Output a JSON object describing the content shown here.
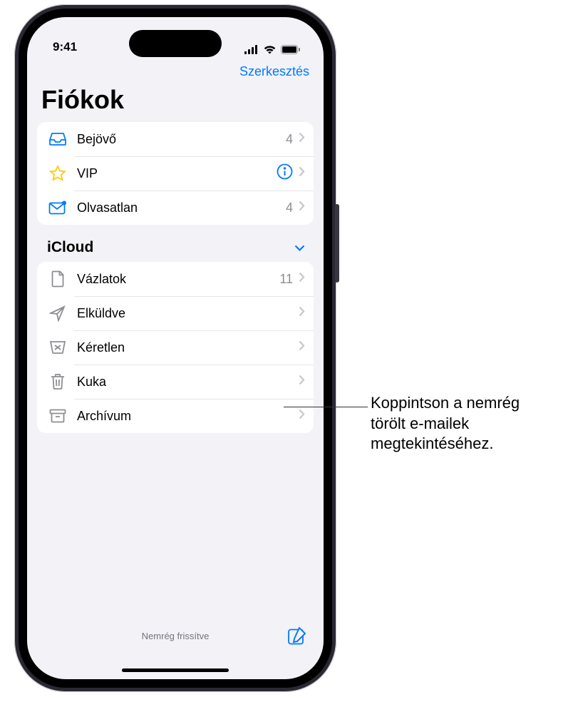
{
  "status": {
    "time": "9:41"
  },
  "nav": {
    "edit": "Szerkesztés"
  },
  "title": "Fiókok",
  "primary_group": [
    {
      "icon": "inbox",
      "label": "Bejövő",
      "count": "4",
      "trailing": "count"
    },
    {
      "icon": "star",
      "label": "VIP",
      "count": "",
      "trailing": "info"
    },
    {
      "icon": "unread",
      "label": "Olvasatlan",
      "count": "4",
      "trailing": "count"
    }
  ],
  "section": {
    "title": "iCloud"
  },
  "icloud_group": [
    {
      "icon": "doc",
      "label": "Vázlatok",
      "count": "11"
    },
    {
      "icon": "send",
      "label": "Elküldve",
      "count": ""
    },
    {
      "icon": "junk",
      "label": "Kéretlen",
      "count": ""
    },
    {
      "icon": "trash",
      "label": "Kuka",
      "count": ""
    },
    {
      "icon": "archive",
      "label": "Archívum",
      "count": ""
    }
  ],
  "toolbar": {
    "status": "Nemrég frissítve"
  },
  "callout": {
    "line1": "Koppintson a nemrég",
    "line2": "törölt e-mailek",
    "line3": "megtekintéséhez."
  }
}
